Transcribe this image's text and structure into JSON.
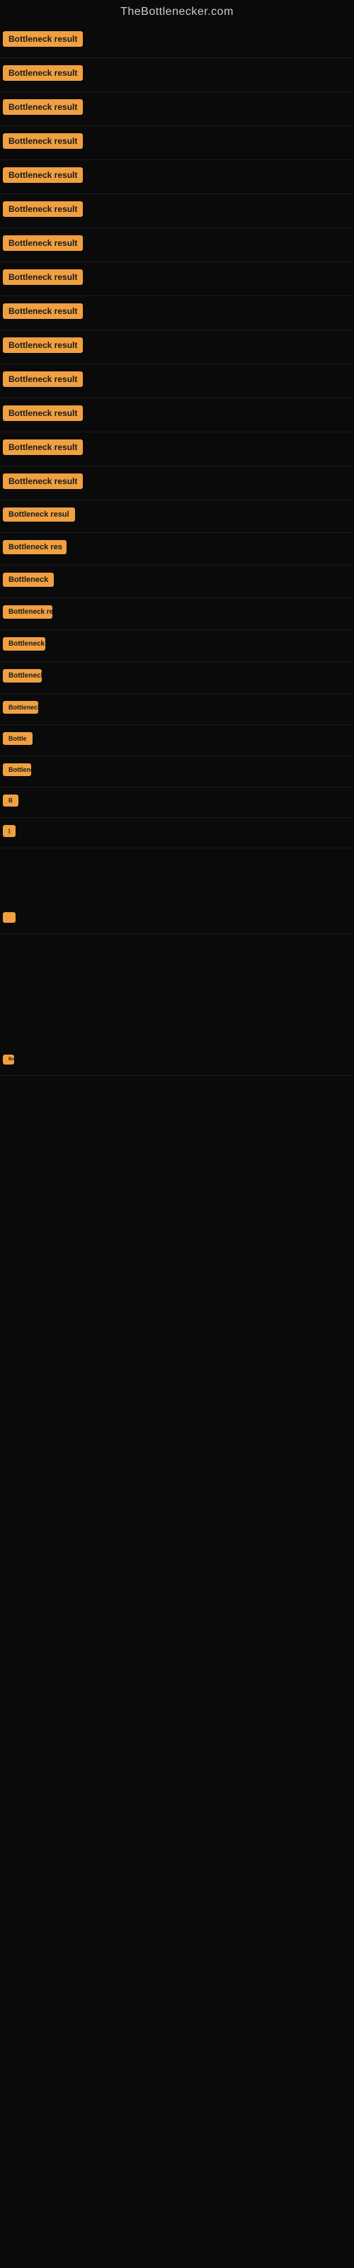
{
  "site": {
    "title": "TheBottlenecker.com"
  },
  "badge_label": "Bottleneck result",
  "rows": [
    {
      "id": 1,
      "label": "Bottleneck result"
    },
    {
      "id": 2,
      "label": "Bottleneck result"
    },
    {
      "id": 3,
      "label": "Bottleneck result"
    },
    {
      "id": 4,
      "label": "Bottleneck result"
    },
    {
      "id": 5,
      "label": "Bottleneck result"
    },
    {
      "id": 6,
      "label": "Bottleneck result"
    },
    {
      "id": 7,
      "label": "Bottleneck result"
    },
    {
      "id": 8,
      "label": "Bottleneck result"
    },
    {
      "id": 9,
      "label": "Bottleneck result"
    },
    {
      "id": 10,
      "label": "Bottleneck result"
    },
    {
      "id": 11,
      "label": "Bottleneck result"
    },
    {
      "id": 12,
      "label": "Bottleneck result"
    },
    {
      "id": 13,
      "label": "Bottleneck result"
    },
    {
      "id": 14,
      "label": "Bottleneck result"
    },
    {
      "id": 15,
      "label": "Bottleneck resul"
    },
    {
      "id": 16,
      "label": "Bottleneck res"
    },
    {
      "id": 17,
      "label": "Bottleneck"
    },
    {
      "id": 18,
      "label": "Bottleneck res"
    },
    {
      "id": 19,
      "label": "Bottleneck"
    },
    {
      "id": 20,
      "label": "Bottleneck"
    },
    {
      "id": 21,
      "label": "Bottleneck r"
    },
    {
      "id": 22,
      "label": "Bottle"
    },
    {
      "id": 23,
      "label": "Bottleneck"
    },
    {
      "id": 24,
      "label": "B"
    },
    {
      "id": 25,
      "label": "|"
    },
    {
      "id": 26,
      "label": ""
    },
    {
      "id": 27,
      "label": "Bo"
    }
  ]
}
